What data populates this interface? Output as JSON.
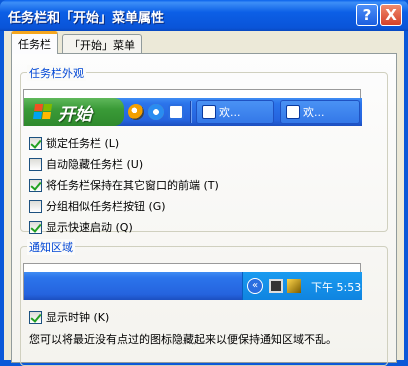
{
  "window": {
    "title": "任务栏和「开始」菜单属性"
  },
  "title_buttons": {
    "help": "?",
    "close": "X"
  },
  "tabs": [
    {
      "label": "任务栏",
      "active": true
    },
    {
      "label": "「开始」菜单",
      "active": false
    }
  ],
  "taskbar_group": {
    "title": "任务栏外观",
    "preview": {
      "start_label": "开始",
      "task_buttons": [
        "欢...",
        "欢..."
      ]
    },
    "options": [
      {
        "label": "锁定任务栏 (L)",
        "checked": true
      },
      {
        "label": "自动隐藏任务栏 (U)",
        "checked": false
      },
      {
        "label": "将任务栏保持在其它窗口的前端 (T)",
        "checked": true
      },
      {
        "label": "分组相似任务栏按钮 (G)",
        "checked": false
      },
      {
        "label": "显示快速启动 (Q)",
        "checked": true
      }
    ]
  },
  "notify_group": {
    "title": "通知区域",
    "preview": {
      "clock": "下午 5:53"
    },
    "options": [
      {
        "label": "显示时钟 (K)",
        "checked": true
      }
    ],
    "description": "您可以将最近没有点过的图标隐藏起来以便保持通知区域不乱。"
  },
  "colors": {
    "titlebar": "#0a58d8",
    "window_bg": "#ece9d8",
    "group_title": "#0046d5",
    "checkmark": "#21a121"
  },
  "icons": {
    "start": "windows-logo-icon",
    "quicklaunch": [
      "media-player-icon",
      "internet-explorer-icon",
      "desktop-icon"
    ],
    "tray": [
      "show-hidden-icons-chevron",
      "network-icon",
      "volume-icon"
    ]
  }
}
